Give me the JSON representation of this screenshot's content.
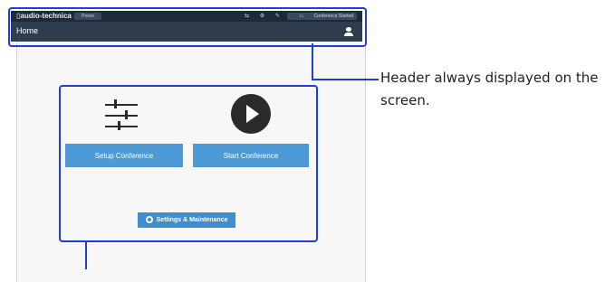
{
  "header": {
    "brand": "audio-technica",
    "badge": "Power",
    "status_chip": "Conference Started",
    "title": "Home"
  },
  "main": {
    "setup_label": "Setup Conference",
    "start_label": "Start Conference",
    "settings_label": "Settings & Maintenance"
  },
  "annotation": {
    "header_note": "Header always displayed on the screen."
  },
  "colors": {
    "header_bg": "#2f3d4e",
    "button_blue": "#4e9ad6",
    "callout_blue": "#1f3fcf"
  }
}
